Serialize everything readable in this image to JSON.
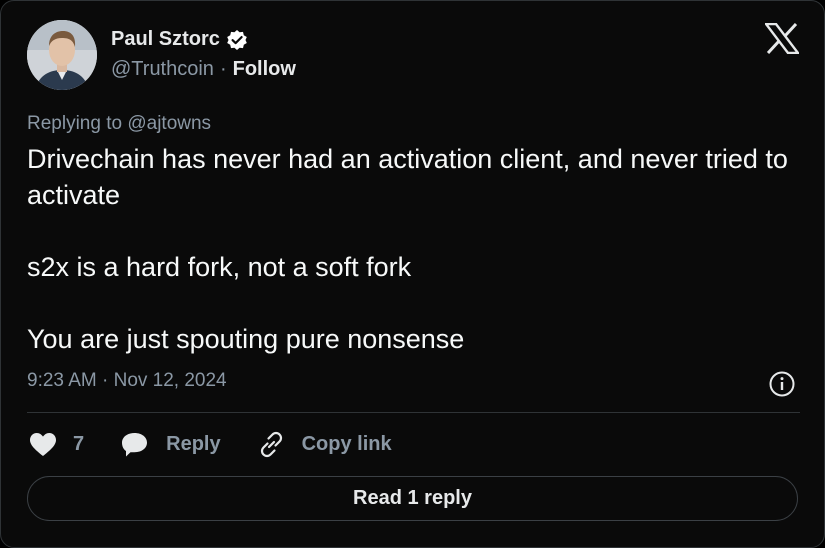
{
  "author": {
    "name": "Paul Sztorc",
    "handle": "@Truthcoin",
    "separator": "·",
    "follow_label": "Follow"
  },
  "tweet": {
    "replying_prefix": "Replying to",
    "replying_to": "@ajtowns",
    "text": "Drivechain has never had an activation client, and never tried to activate\n\ns2x is a hard fork, not a soft fork\n\nYou are just spouting pure nonsense",
    "timestamp": "9:23 AM · Nov 12, 2024"
  },
  "actions": {
    "like_count": "7",
    "reply_label": "Reply",
    "copy_link_label": "Copy link"
  },
  "read_replies_label": "Read 1 reply",
  "icons": [
    "verified-badge-icon",
    "x-logo-icon",
    "info-icon",
    "heart-icon",
    "reply-bubble-icon",
    "link-icon"
  ],
  "colors": {
    "background": "#000000",
    "card": "#0a0a0a",
    "text": "#e7e9ea",
    "muted": "#8b98a5",
    "border": "#2f3336"
  }
}
